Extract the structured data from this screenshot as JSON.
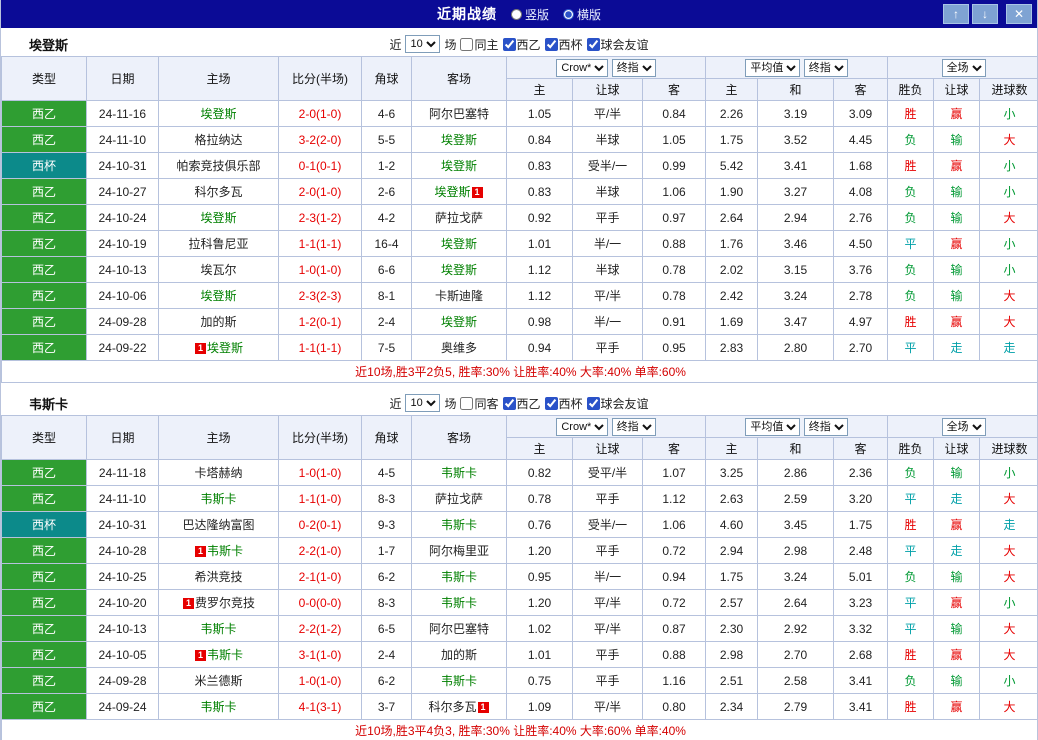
{
  "titlebar": {
    "title": "近期战绩",
    "layout_options": [
      {
        "label": "竖版",
        "selected": false
      },
      {
        "label": "横版",
        "selected": true
      }
    ],
    "buttons": {
      "up": "↑",
      "down": "↓",
      "close": "✕"
    }
  },
  "filters": {
    "prefix": "近",
    "match_count": "10",
    "suffix": "场",
    "leagues": [
      "西乙",
      "西杯",
      "球会友谊"
    ],
    "league_checked": [
      true,
      true,
      true
    ]
  },
  "columns": {
    "left": [
      "类型",
      "日期",
      "主场",
      "比分(半场)",
      "角球",
      "客场"
    ],
    "asian_sub": [
      "主",
      "让球",
      "客"
    ],
    "euro_sub": [
      "主",
      "和",
      "客"
    ],
    "result_sub": [
      "胜负",
      "让球",
      "进球数"
    ],
    "dropdowns": {
      "bookmaker": "Crow*",
      "stage1": "终指",
      "average": "平均值",
      "stage2": "终指",
      "scope": "全场"
    }
  },
  "colors": {
    "accent": "#0b0b96",
    "liga": "#2f9e32",
    "cup": "#0c8a8a",
    "score": "#e60000",
    "focus": "#008000",
    "badge": "#e60000",
    "win": "#e60000",
    "loss": "#009933",
    "draw": "#00a0a8",
    "footer": "#d40000"
  },
  "sections": [
    {
      "team": "埃登斯",
      "same_filter_label": "同主",
      "same_filter_checked": false,
      "footer": "近10场,胜3平2负5, 胜率:30% 让胜率:40% 大率:40% 单率:60%",
      "rows": [
        {
          "league": "西乙",
          "date": "24-11-16",
          "home": "埃登斯",
          "home_focus": true,
          "score": "2-0(1-0)",
          "corner": "4-6",
          "away": "阿尔巴塞特",
          "odds": [
            "1.05",
            "平/半",
            "0.84",
            "2.26",
            "3.19",
            "3.09"
          ],
          "res": [
            {
              "t": "胜",
              "c": "w"
            },
            {
              "t": "赢",
              "c": "w"
            },
            {
              "t": "小",
              "c": "l"
            }
          ]
        },
        {
          "league": "西乙",
          "date": "24-11-10",
          "home": "格拉纳达",
          "score": "3-2(2-0)",
          "corner": "5-5",
          "away": "埃登斯",
          "away_focus": true,
          "odds": [
            "0.84",
            "半球",
            "1.05",
            "1.75",
            "3.52",
            "4.45"
          ],
          "res": [
            {
              "t": "负",
              "c": "l"
            },
            {
              "t": "输",
              "c": "l"
            },
            {
              "t": "大",
              "c": "w"
            }
          ]
        },
        {
          "league": "西杯",
          "cup": true,
          "date": "24-10-31",
          "home": "帕索竞技俱乐部",
          "score": "0-1(0-1)",
          "corner": "1-2",
          "away": "埃登斯",
          "away_focus": true,
          "odds": [
            "0.83",
            "受半/一",
            "0.99",
            "5.42",
            "3.41",
            "1.68"
          ],
          "res": [
            {
              "t": "胜",
              "c": "w"
            },
            {
              "t": "赢",
              "c": "w"
            },
            {
              "t": "小",
              "c": "l"
            }
          ]
        },
        {
          "league": "西乙",
          "date": "24-10-27",
          "home": "科尔多瓦",
          "score": "2-0(1-0)",
          "corner": "2-6",
          "away": "埃登斯",
          "away_focus": true,
          "away_post": "1",
          "odds": [
            "0.83",
            "半球",
            "1.06",
            "1.90",
            "3.27",
            "4.08"
          ],
          "res": [
            {
              "t": "负",
              "c": "l"
            },
            {
              "t": "输",
              "c": "l"
            },
            {
              "t": "小",
              "c": "l"
            }
          ]
        },
        {
          "league": "西乙",
          "date": "24-10-24",
          "home": "埃登斯",
          "home_focus": true,
          "score": "2-3(1-2)",
          "corner": "4-2",
          "away": "萨拉戈萨",
          "odds": [
            "0.92",
            "平手",
            "0.97",
            "2.64",
            "2.94",
            "2.76"
          ],
          "res": [
            {
              "t": "负",
              "c": "l"
            },
            {
              "t": "输",
              "c": "l"
            },
            {
              "t": "大",
              "c": "w"
            }
          ]
        },
        {
          "league": "西乙",
          "date": "24-10-19",
          "home": "拉科鲁尼亚",
          "score": "1-1(1-1)",
          "corner": "16-4",
          "away": "埃登斯",
          "away_focus": true,
          "odds": [
            "1.01",
            "半/一",
            "0.88",
            "1.76",
            "3.46",
            "4.50"
          ],
          "res": [
            {
              "t": "平",
              "c": "d"
            },
            {
              "t": "赢",
              "c": "w"
            },
            {
              "t": "小",
              "c": "l"
            }
          ]
        },
        {
          "league": "西乙",
          "date": "24-10-13",
          "home": "埃瓦尔",
          "score": "1-0(1-0)",
          "corner": "6-6",
          "away": "埃登斯",
          "away_focus": true,
          "odds": [
            "1.12",
            "半球",
            "0.78",
            "2.02",
            "3.15",
            "3.76"
          ],
          "res": [
            {
              "t": "负",
              "c": "l"
            },
            {
              "t": "输",
              "c": "l"
            },
            {
              "t": "小",
              "c": "l"
            }
          ]
        },
        {
          "league": "西乙",
          "date": "24-10-06",
          "home": "埃登斯",
          "home_focus": true,
          "score": "2-3(2-3)",
          "corner": "8-1",
          "away": "卡斯迪隆",
          "odds": [
            "1.12",
            "平/半",
            "0.78",
            "2.42",
            "3.24",
            "2.78"
          ],
          "res": [
            {
              "t": "负",
              "c": "l"
            },
            {
              "t": "输",
              "c": "l"
            },
            {
              "t": "大",
              "c": "w"
            }
          ]
        },
        {
          "league": "西乙",
          "date": "24-09-28",
          "home": "加的斯",
          "score": "1-2(0-1)",
          "corner": "2-4",
          "away": "埃登斯",
          "away_focus": true,
          "odds": [
            "0.98",
            "半/一",
            "0.91",
            "1.69",
            "3.47",
            "4.97"
          ],
          "res": [
            {
              "t": "胜",
              "c": "w"
            },
            {
              "t": "赢",
              "c": "w"
            },
            {
              "t": "大",
              "c": "w"
            }
          ]
        },
        {
          "league": "西乙",
          "date": "24-09-22",
          "home": "埃登斯",
          "home_focus": true,
          "home_pre": "1",
          "score": "1-1(1-1)",
          "corner": "7-5",
          "away": "奥维多",
          "odds": [
            "0.94",
            "平手",
            "0.95",
            "2.83",
            "2.80",
            "2.70"
          ],
          "res": [
            {
              "t": "平",
              "c": "d"
            },
            {
              "t": "走",
              "c": "d"
            },
            {
              "t": "走",
              "c": "d"
            }
          ]
        }
      ]
    },
    {
      "team": "韦斯卡",
      "same_filter_label": "同客",
      "same_filter_checked": false,
      "footer": "近10场,胜3平4负3, 胜率:30% 让胜率:40% 大率:60% 单率:40%",
      "rows": [
        {
          "league": "西乙",
          "date": "24-11-18",
          "home": "卡塔赫纳",
          "score": "1-0(1-0)",
          "corner": "4-5",
          "away": "韦斯卡",
          "away_focus": true,
          "odds": [
            "0.82",
            "受平/半",
            "1.07",
            "3.25",
            "2.86",
            "2.36"
          ],
          "res": [
            {
              "t": "负",
              "c": "l"
            },
            {
              "t": "输",
              "c": "l"
            },
            {
              "t": "小",
              "c": "l"
            }
          ]
        },
        {
          "league": "西乙",
          "date": "24-11-10",
          "home": "韦斯卡",
          "home_focus": true,
          "score": "1-1(1-0)",
          "corner": "8-3",
          "away": "萨拉戈萨",
          "odds": [
            "0.78",
            "平手",
            "1.12",
            "2.63",
            "2.59",
            "3.20"
          ],
          "res": [
            {
              "t": "平",
              "c": "d"
            },
            {
              "t": "走",
              "c": "d"
            },
            {
              "t": "大",
              "c": "w"
            }
          ]
        },
        {
          "league": "西杯",
          "cup": true,
          "date": "24-10-31",
          "home": "巴达隆纳富图",
          "score": "0-2(0-1)",
          "corner": "9-3",
          "away": "韦斯卡",
          "away_focus": true,
          "odds": [
            "0.76",
            "受半/一",
            "1.06",
            "4.60",
            "3.45",
            "1.75"
          ],
          "res": [
            {
              "t": "胜",
              "c": "w"
            },
            {
              "t": "赢",
              "c": "w"
            },
            {
              "t": "走",
              "c": "d"
            }
          ]
        },
        {
          "league": "西乙",
          "date": "24-10-28",
          "home": "韦斯卡",
          "home_focus": true,
          "home_pre": "1",
          "score": "2-2(1-0)",
          "corner": "1-7",
          "away": "阿尔梅里亚",
          "odds": [
            "1.20",
            "平手",
            "0.72",
            "2.94",
            "2.98",
            "2.48"
          ],
          "res": [
            {
              "t": "平",
              "c": "d"
            },
            {
              "t": "走",
              "c": "d"
            },
            {
              "t": "大",
              "c": "w"
            }
          ]
        },
        {
          "league": "西乙",
          "date": "24-10-25",
          "home": "希洪竞技",
          "score": "2-1(1-0)",
          "corner": "6-2",
          "away": "韦斯卡",
          "away_focus": true,
          "odds": [
            "0.95",
            "半/一",
            "0.94",
            "1.75",
            "3.24",
            "5.01"
          ],
          "res": [
            {
              "t": "负",
              "c": "l"
            },
            {
              "t": "输",
              "c": "l"
            },
            {
              "t": "大",
              "c": "w"
            }
          ]
        },
        {
          "league": "西乙",
          "date": "24-10-20",
          "home": "费罗尔竞技",
          "home_pre": "1",
          "score": "0-0(0-0)",
          "corner": "8-3",
          "away": "韦斯卡",
          "away_focus": true,
          "odds": [
            "1.20",
            "平/半",
            "0.72",
            "2.57",
            "2.64",
            "3.23"
          ],
          "res": [
            {
              "t": "平",
              "c": "d"
            },
            {
              "t": "赢",
              "c": "w"
            },
            {
              "t": "小",
              "c": "l"
            }
          ]
        },
        {
          "league": "西乙",
          "date": "24-10-13",
          "home": "韦斯卡",
          "home_focus": true,
          "score": "2-2(1-2)",
          "corner": "6-5",
          "away": "阿尔巴塞特",
          "odds": [
            "1.02",
            "平/半",
            "0.87",
            "2.30",
            "2.92",
            "3.32"
          ],
          "res": [
            {
              "t": "平",
              "c": "d"
            },
            {
              "t": "输",
              "c": "l"
            },
            {
              "t": "大",
              "c": "w"
            }
          ]
        },
        {
          "league": "西乙",
          "date": "24-10-05",
          "home": "韦斯卡",
          "home_focus": true,
          "home_pre": "1",
          "score": "3-1(1-0)",
          "corner": "2-4",
          "away": "加的斯",
          "odds": [
            "1.01",
            "平手",
            "0.88",
            "2.98",
            "2.70",
            "2.68"
          ],
          "res": [
            {
              "t": "胜",
              "c": "w"
            },
            {
              "t": "赢",
              "c": "w"
            },
            {
              "t": "大",
              "c": "w"
            }
          ]
        },
        {
          "league": "西乙",
          "date": "24-09-28",
          "home": "米兰德斯",
          "score": "1-0(1-0)",
          "corner": "6-2",
          "away": "韦斯卡",
          "away_focus": true,
          "odds": [
            "0.75",
            "平手",
            "1.16",
            "2.51",
            "2.58",
            "3.41"
          ],
          "res": [
            {
              "t": "负",
              "c": "l"
            },
            {
              "t": "输",
              "c": "l"
            },
            {
              "t": "小",
              "c": "l"
            }
          ]
        },
        {
          "league": "西乙",
          "date": "24-09-24",
          "home": "韦斯卡",
          "home_focus": true,
          "score": "4-1(3-1)",
          "corner": "3-7",
          "away": "科尔多瓦",
          "away_post": "1",
          "odds": [
            "1.09",
            "平/半",
            "0.80",
            "2.34",
            "2.79",
            "3.41"
          ],
          "res": [
            {
              "t": "胜",
              "c": "w"
            },
            {
              "t": "赢",
              "c": "w"
            },
            {
              "t": "大",
              "c": "w"
            }
          ]
        }
      ]
    }
  ]
}
